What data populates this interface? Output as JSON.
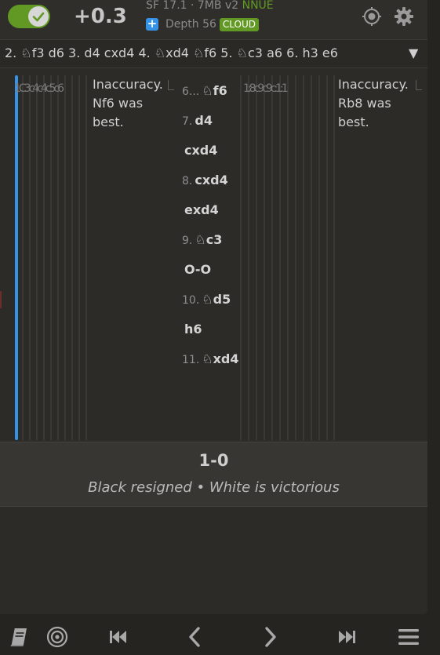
{
  "engine": {
    "evaluation": "+0.3",
    "name": "SF 17.1 · 7MB v2",
    "nnue": "NNUE",
    "depth": "Depth 56",
    "cloud": "CLOUD",
    "plus": "+",
    "toggle_on": true,
    "icons": [
      "check-icon",
      "target-icon",
      "gear-icon"
    ]
  },
  "pv": {
    "line": "2. ♘f3 d6 3. d4 cxd4 4. ♘xd4 ♘f6 5. ♘c3 a6 6. h3 e6",
    "toggle": "▼"
  },
  "variation_left": {
    "ticks": "1C3c4c4c5c6",
    "comment": "Inaccuracy.\nNf6 was\nbest."
  },
  "variation_right": {
    "ticks": "1:8c9c9c:1:1",
    "comment": "Inaccuracy.\nRb8 was\nbest."
  },
  "moves": [
    {
      "num": "6...",
      "san": "♘f6"
    },
    {
      "num": "7.",
      "san": "d4"
    },
    {
      "num": "",
      "san": "cxd4"
    },
    {
      "num": "8.",
      "san": "cxd4"
    },
    {
      "num": "",
      "san": "exd4"
    },
    {
      "num": "9.",
      "san": "♘c3"
    },
    {
      "num": "",
      "san": "O-O"
    },
    {
      "num": "10.",
      "san": "♘d5"
    },
    {
      "num": "",
      "san": "h6"
    },
    {
      "num": "11.",
      "san": "♘xd4"
    }
  ],
  "result": {
    "score": "1-0",
    "status": "Black resigned • White is victorious"
  },
  "colors": {
    "accent_green": "#629924",
    "accent_blue": "#3692e7",
    "background": "#262421"
  },
  "controls": [
    "book-icon",
    "target-icon",
    "first-icon",
    "prev-icon",
    "next-icon",
    "last-icon",
    "menu-icon"
  ]
}
